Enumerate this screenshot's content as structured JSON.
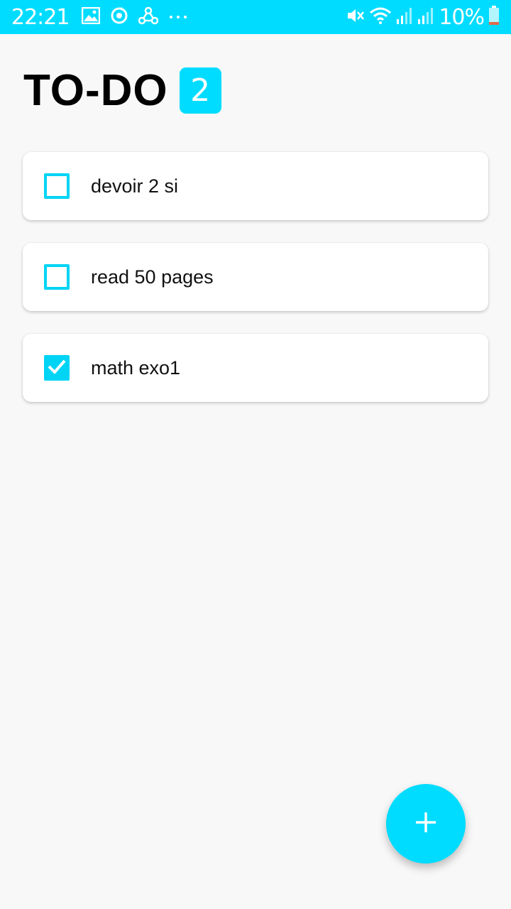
{
  "status_bar": {
    "time": "22:21",
    "battery": "10%",
    "left_icons": [
      "image-icon",
      "sync-circle-icon",
      "share-icon",
      "more-dots-icon"
    ],
    "right_icons": [
      "vibrate-mute-icon",
      "wifi-icon",
      "signal-icon",
      "signal-icon-2",
      "battery-icon"
    ]
  },
  "header": {
    "title": "TO-DO",
    "count": "2"
  },
  "tasks": [
    {
      "label": "devoir 2 si",
      "checked": false
    },
    {
      "label": "read 50 pages",
      "checked": false
    },
    {
      "label": "math exo1",
      "checked": true
    }
  ],
  "fab": {
    "icon": "plus-icon"
  },
  "colors": {
    "accent": "#00dcff",
    "checkbox": "#00d4f5",
    "background": "#f8f8f8"
  }
}
